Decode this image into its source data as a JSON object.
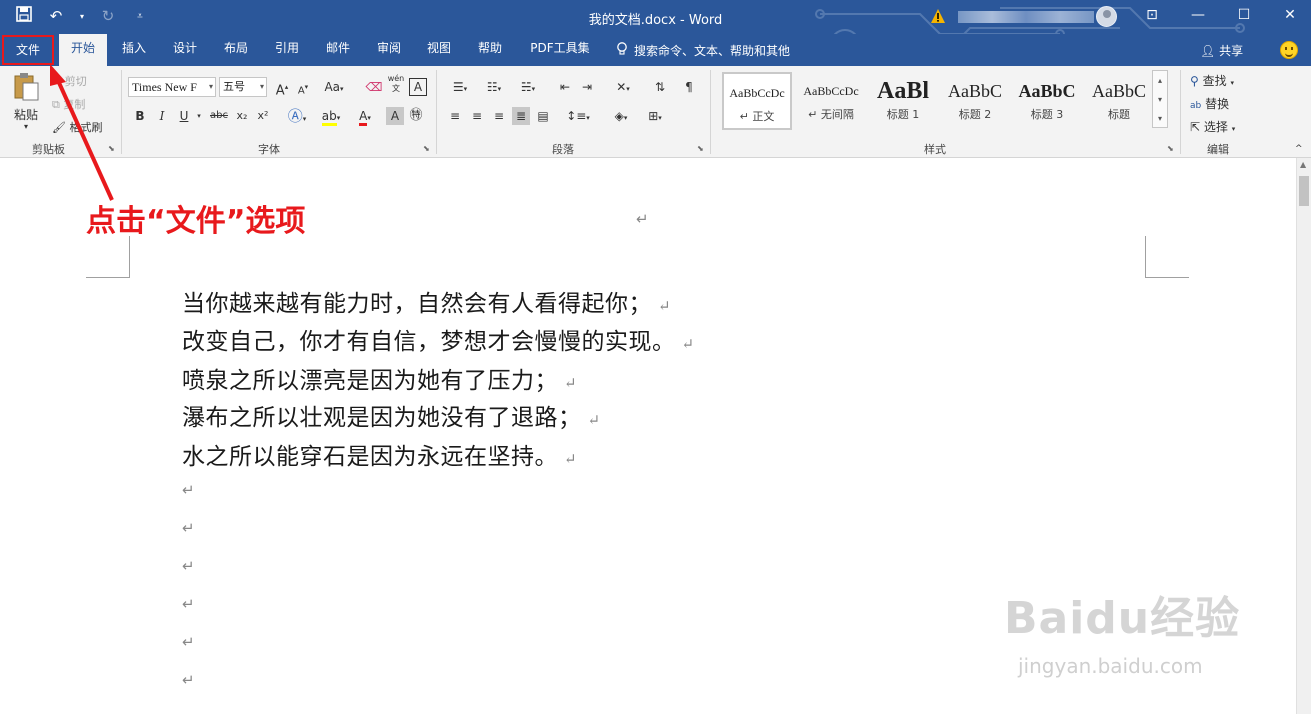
{
  "window": {
    "title": "我的文档.docx - Word",
    "icons": [
      "save-icon",
      "undo-icon",
      "redo-icon",
      "customize-qat-icon",
      "warning-icon",
      "ribbon-display-icon",
      "minimize-icon",
      "maximize-icon",
      "close-icon"
    ]
  },
  "tabs": [
    "文件",
    "开始",
    "插入",
    "设计",
    "布局",
    "引用",
    "邮件",
    "审阅",
    "视图",
    "帮助",
    "PDF工具集"
  ],
  "tell_me": "搜索命令、文本、帮助和其他",
  "share": "共享",
  "ribbon": {
    "clipboard": {
      "paste": "粘贴",
      "cut": "剪切",
      "copy": "复制",
      "format_painter": "格式刷",
      "label": "剪贴板"
    },
    "font": {
      "name": "Times New F",
      "size": "五号",
      "label": "字体",
      "grow": "A",
      "shrink": "A",
      "case": "Aa",
      "bold": "B",
      "italic": "I",
      "underline": "U",
      "strike": "abc",
      "sub": "x₂",
      "sup": "x²",
      "phonetic": "wén",
      "border_char": "A"
    },
    "paragraph": {
      "label": "段落"
    },
    "styles": {
      "label": "样式",
      "items": [
        {
          "sample": "AaBbCcDc",
          "name": "正文"
        },
        {
          "sample": "AaBbCcDc",
          "name": "无间隔"
        },
        {
          "sample": "AaBl",
          "name": "标题 1"
        },
        {
          "sample": "AaBbC",
          "name": "标题 2"
        },
        {
          "sample": "AaBbC",
          "name": "标题 3"
        },
        {
          "sample": "AaBbC",
          "name": "标题"
        }
      ]
    },
    "editing": {
      "find": "查找",
      "replace": "替换",
      "select": "选择",
      "label": "编辑"
    }
  },
  "document": {
    "lines": [
      "当你越来越有能力时，自然会有人看得起你；",
      "改变自己，你才有自信，梦想才会慢慢的实现。",
      "喷泉之所以漂亮是因为她有了压力；",
      "瀑布之所以壮观是因为她没有了退路；",
      "水之所以能穿石是因为永远在坚持。"
    ],
    "paragraph_mark": "↵"
  },
  "annotation": {
    "text": "点击“文件”选项",
    "color": "#e8191c"
  },
  "watermark": {
    "logo": "Baidu经验",
    "url": "jingyan.baidu.com"
  },
  "colors": {
    "title_bar": "#2b579a",
    "ribbon": "#f3f3f3",
    "highlight": "#e8191c"
  }
}
